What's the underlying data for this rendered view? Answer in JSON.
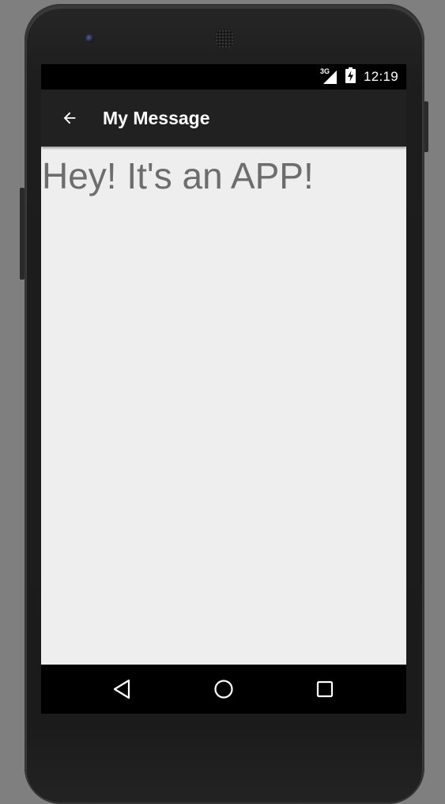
{
  "status_bar": {
    "network_label": "3G",
    "time": "12:19",
    "icons": [
      "signal-icon",
      "battery-charging-icon"
    ]
  },
  "app_bar": {
    "title": "My Message",
    "back_icon": "arrow-left-icon"
  },
  "content": {
    "message": "Hey! It's an APP!"
  },
  "nav_bar": {
    "buttons": [
      "back-triangle-icon",
      "home-circle-icon",
      "recents-square-icon"
    ]
  },
  "colors": {
    "app_bar": "#212121",
    "content_background": "#eeeeee",
    "message_text": "#6d6d6d",
    "device_background": "#7f7f7f"
  }
}
